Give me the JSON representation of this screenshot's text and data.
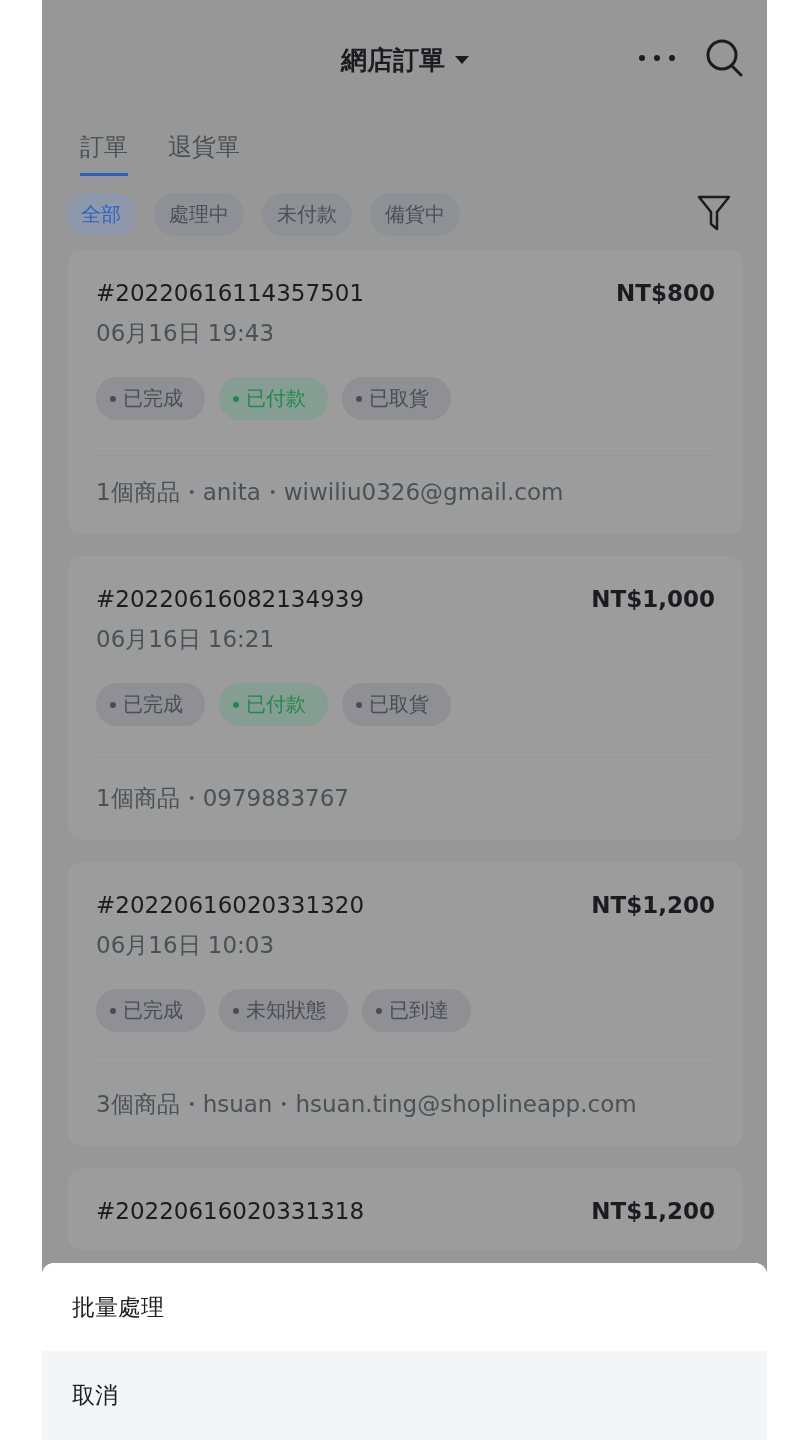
{
  "header": {
    "title": "網店訂單"
  },
  "tabs": [
    {
      "label": "訂單",
      "selected": true
    },
    {
      "label": "退貨單",
      "selected": false
    }
  ],
  "filters": [
    {
      "label": "全部",
      "selected": true
    },
    {
      "label": "處理中",
      "selected": false
    },
    {
      "label": "未付款",
      "selected": false
    },
    {
      "label": "備貨中",
      "selected": false
    }
  ],
  "orders": [
    {
      "number": "#20220616114357501",
      "amount": "NT$800",
      "date": "06月16日 19:43",
      "tags": [
        {
          "label": "已完成",
          "color": "#4a4d55"
        },
        {
          "label": "已付款",
          "color": "#1f8a4a"
        },
        {
          "label": "已取貨",
          "color": "#4a4d55"
        }
      ],
      "summary": "1個商品・anita・wiwiliu0326@gmail.com"
    },
    {
      "number": "#20220616082134939",
      "amount": "NT$1,000",
      "date": "06月16日 16:21",
      "tags": [
        {
          "label": "已完成",
          "color": "#4a4d55"
        },
        {
          "label": "已付款",
          "color": "#1f8a4a"
        },
        {
          "label": "已取貨",
          "color": "#4a4d55"
        }
      ],
      "summary": "1個商品・0979883767"
    },
    {
      "number": "#20220616020331320",
      "amount": "NT$1,200",
      "date": "06月16日 10:03",
      "tags": [
        {
          "label": "已完成",
          "color": "#4a4d55"
        },
        {
          "label": "未知狀態",
          "color": "#4a4d55"
        },
        {
          "label": "已到達",
          "color": "#4a4d55"
        }
      ],
      "summary": "3個商品・hsuan・hsuan.ting@shoplineapp.com"
    },
    {
      "number": "#20220616020331318",
      "amount": "NT$1,200"
    }
  ],
  "action_sheet": {
    "options": [
      "批量處理"
    ],
    "cancel": "取消"
  }
}
